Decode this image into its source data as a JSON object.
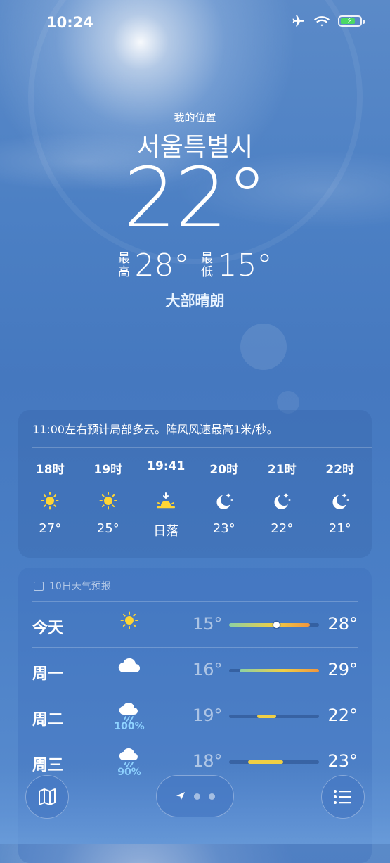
{
  "status_bar": {
    "time": "10:24",
    "icons": [
      "airplane-icon",
      "wifi-icon",
      "battery-charging-icon"
    ]
  },
  "header": {
    "location_label": "我的位置",
    "city": "서울특별시",
    "temperature": "22°",
    "high_label": "最高",
    "high": "28°",
    "low_label": "最低",
    "low": "15°",
    "condition": "大部晴朗"
  },
  "hourly": {
    "summary": "11:00左右预计局部多云。阵风风速最高1米/秒。",
    "items": [
      {
        "time": "18时",
        "icon": "sun-icon",
        "value": "27°"
      },
      {
        "time": "19时",
        "icon": "sun-icon",
        "value": "25°"
      },
      {
        "time": "19:41",
        "icon": "sunset-icon",
        "value": "日落"
      },
      {
        "time": "20时",
        "icon": "moon-stars-icon",
        "value": "23°"
      },
      {
        "time": "21时",
        "icon": "moon-stars-icon",
        "value": "22°"
      },
      {
        "time": "22时",
        "icon": "moon-stars-icon",
        "value": "21°"
      }
    ]
  },
  "daily": {
    "title": "10日天气预报",
    "days": [
      {
        "day": "今天",
        "icon": "sun-icon",
        "precip": "",
        "low": "15°",
        "high": "28°",
        "range_start": 0.0,
        "range_end": 0.9,
        "current": 0.53
      },
      {
        "day": "周一",
        "icon": "cloud-icon",
        "precip": "",
        "low": "16°",
        "high": "29°",
        "range_start": 0.12,
        "range_end": 1.0,
        "current": null
      },
      {
        "day": "周二",
        "icon": "rain-icon",
        "precip": "100%",
        "low": "19°",
        "high": "22°",
        "range_start": 0.31,
        "range_end": 0.52,
        "current": null
      },
      {
        "day": "周三",
        "icon": "rain-icon",
        "precip": "90%",
        "low": "18°",
        "high": "23°",
        "range_start": 0.21,
        "range_end": 0.6,
        "current": null
      }
    ]
  },
  "colors": {
    "bar_cool": "#8cd1a4",
    "bar_mid": "#f0cf45",
    "bar_warm": "#f0953e",
    "precip": "#8fd3ff"
  }
}
